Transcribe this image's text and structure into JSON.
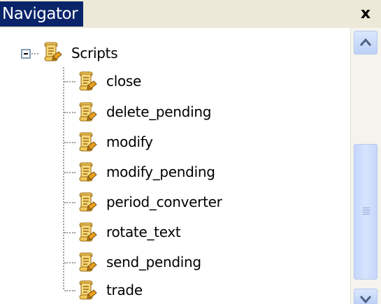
{
  "window": {
    "title": "Navigator",
    "close_glyph": "x"
  },
  "tree": {
    "root": {
      "label": "Scripts",
      "icon": "script-scroll-icon",
      "expanded": true
    },
    "items": [
      {
        "label": "close",
        "icon": "script-scroll-icon"
      },
      {
        "label": "delete_pending",
        "icon": "script-scroll-icon"
      },
      {
        "label": "modify",
        "icon": "script-scroll-icon"
      },
      {
        "label": "modify_pending",
        "icon": "script-scroll-icon"
      },
      {
        "label": "period_converter",
        "icon": "script-scroll-icon"
      },
      {
        "label": "rotate_text",
        "icon": "script-scroll-icon"
      },
      {
        "label": "send_pending",
        "icon": "script-scroll-icon"
      },
      {
        "label": "trade",
        "icon": "script-scroll-icon"
      }
    ]
  },
  "scrollbar": {
    "up_icon": "chevron-up-icon",
    "down_icon": "chevron-down-icon",
    "thumb_icon": "grip-icon"
  },
  "colors": {
    "title_background": "#0a246a",
    "title_text": "#ffffff",
    "scroll_thumb": "#c5d6fb",
    "icon_scroll": "#e8b84a"
  }
}
